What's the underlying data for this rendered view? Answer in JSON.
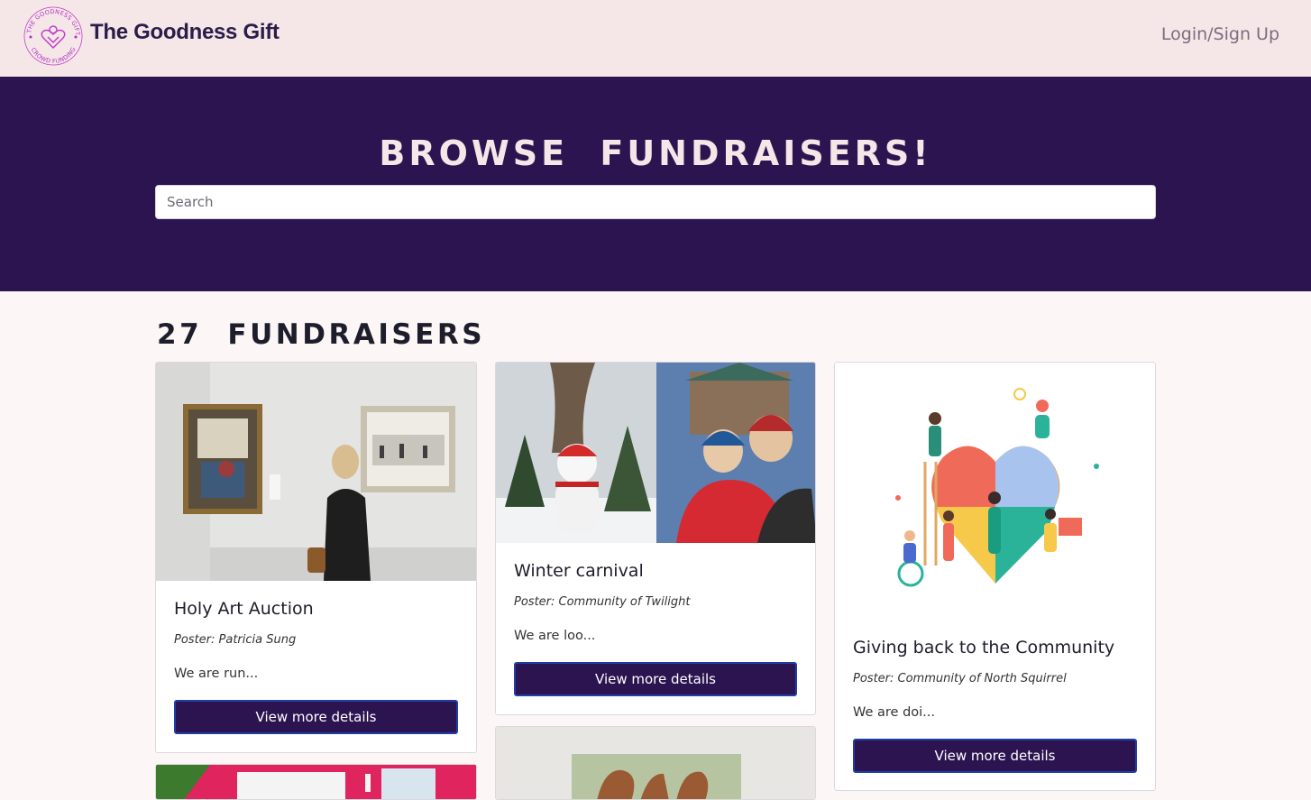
{
  "header": {
    "logo_ring_text_top": "THE GOODNESS GIFT",
    "logo_ring_text_bottom": "CROWD FUNDING",
    "brand": "The Goodness Gift",
    "login_label": "Login/Sign Up"
  },
  "hero": {
    "title": "Browse Fundraisers!",
    "search_placeholder": "Search"
  },
  "results": {
    "count_title": "27 Fundraisers"
  },
  "cards": [
    {
      "title": "Holy Art Auction",
      "poster": "Poster: Patricia Sung",
      "desc": "We are run...",
      "button": "View more details",
      "image": "art-gallery-photo"
    },
    {
      "title": "Winter carnival",
      "poster": "Poster: Community of Twilight",
      "desc": "We are loo...",
      "button": "View more details",
      "image": "winter-carnival-photo"
    },
    {
      "title": "Giving back to the Community",
      "poster": "Poster: Community of North Squirrel",
      "desc": "We are doi...",
      "button": "View more details",
      "image": "community-heart-illustration"
    }
  ],
  "colors": {
    "topbar": "#f5e6e8",
    "hero": "#2c1451",
    "button": "#2c1451",
    "button_border": "#1f3fa6",
    "page": "#fdf6f6",
    "logo_accent": "#c040c8"
  }
}
